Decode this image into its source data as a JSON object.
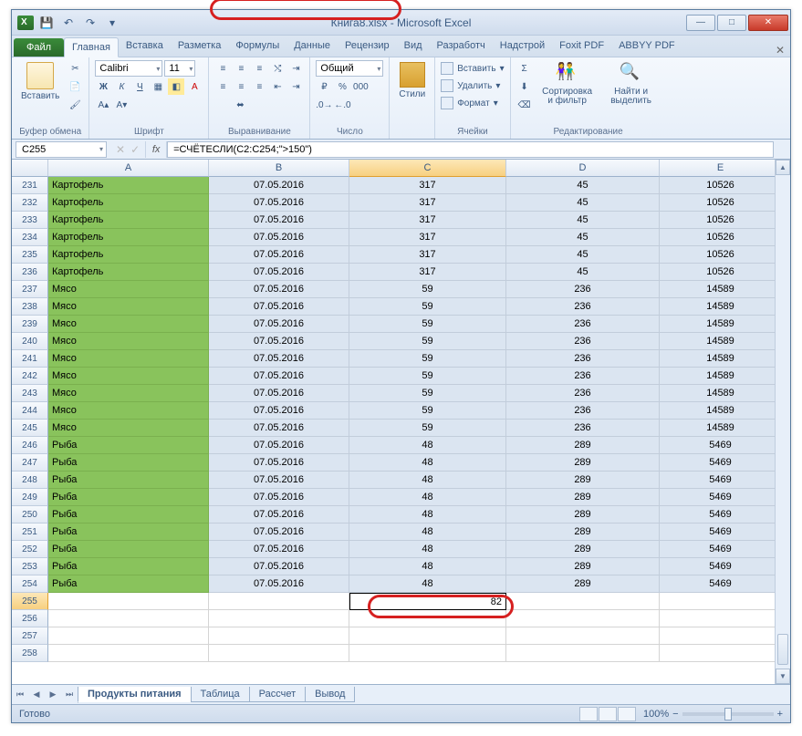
{
  "window": {
    "title": "Книга8.xlsx - Microsoft Excel"
  },
  "qat": {
    "save": "💾",
    "undo": "↶",
    "redo": "↷",
    "customize": "▾"
  },
  "win_controls": {
    "min": "—",
    "max": "□",
    "close": "✕"
  },
  "ribbon_tabs": {
    "file": "Файл",
    "items": [
      "Главная",
      "Вставка",
      "Разметка",
      "Формулы",
      "Данные",
      "Рецензир",
      "Вид",
      "Разработч",
      "Надстрой",
      "Foxit PDF",
      "ABBYY PDF"
    ],
    "active_index": 0
  },
  "ribbon": {
    "clipboard": {
      "paste": "Вставить",
      "label": "Буфер обмена"
    },
    "font": {
      "name": "Calibri",
      "size": "11",
      "bold": "Ж",
      "italic": "К",
      "underline": "Ч",
      "label": "Шрифт"
    },
    "alignment": {
      "label": "Выравнивание"
    },
    "number": {
      "format": "Общий",
      "label": "Число"
    },
    "styles": {
      "btn": "Стили",
      "label": ""
    },
    "cells": {
      "insert": "Вставить",
      "delete": "Удалить",
      "format": "Формат",
      "label": "Ячейки"
    },
    "editing": {
      "sort": "Сортировка и фильтр",
      "find": "Найти и выделить",
      "label": "Редактирование"
    }
  },
  "formula_bar": {
    "name_box": "C255",
    "fx": "fx",
    "formula": "=СЧЁТЕСЛИ(C2:C254;\">150\")"
  },
  "columns": [
    "",
    "A",
    "B",
    "C",
    "D",
    "E"
  ],
  "selected_column_index": 3,
  "rows": [
    {
      "n": 231,
      "a": "Картофель",
      "b": "07.05.2016",
      "c": "317",
      "d": "45",
      "e": "10526"
    },
    {
      "n": 232,
      "a": "Картофель",
      "b": "07.05.2016",
      "c": "317",
      "d": "45",
      "e": "10526"
    },
    {
      "n": 233,
      "a": "Картофель",
      "b": "07.05.2016",
      "c": "317",
      "d": "45",
      "e": "10526"
    },
    {
      "n": 234,
      "a": "Картофель",
      "b": "07.05.2016",
      "c": "317",
      "d": "45",
      "e": "10526"
    },
    {
      "n": 235,
      "a": "Картофель",
      "b": "07.05.2016",
      "c": "317",
      "d": "45",
      "e": "10526"
    },
    {
      "n": 236,
      "a": "Картофель",
      "b": "07.05.2016",
      "c": "317",
      "d": "45",
      "e": "10526"
    },
    {
      "n": 237,
      "a": "Мясо",
      "b": "07.05.2016",
      "c": "59",
      "d": "236",
      "e": "14589"
    },
    {
      "n": 238,
      "a": "Мясо",
      "b": "07.05.2016",
      "c": "59",
      "d": "236",
      "e": "14589"
    },
    {
      "n": 239,
      "a": "Мясо",
      "b": "07.05.2016",
      "c": "59",
      "d": "236",
      "e": "14589"
    },
    {
      "n": 240,
      "a": "Мясо",
      "b": "07.05.2016",
      "c": "59",
      "d": "236",
      "e": "14589"
    },
    {
      "n": 241,
      "a": "Мясо",
      "b": "07.05.2016",
      "c": "59",
      "d": "236",
      "e": "14589"
    },
    {
      "n": 242,
      "a": "Мясо",
      "b": "07.05.2016",
      "c": "59",
      "d": "236",
      "e": "14589"
    },
    {
      "n": 243,
      "a": "Мясо",
      "b": "07.05.2016",
      "c": "59",
      "d": "236",
      "e": "14589"
    },
    {
      "n": 244,
      "a": "Мясо",
      "b": "07.05.2016",
      "c": "59",
      "d": "236",
      "e": "14589"
    },
    {
      "n": 245,
      "a": "Мясо",
      "b": "07.05.2016",
      "c": "59",
      "d": "236",
      "e": "14589"
    },
    {
      "n": 246,
      "a": "Рыба",
      "b": "07.05.2016",
      "c": "48",
      "d": "289",
      "e": "5469"
    },
    {
      "n": 247,
      "a": "Рыба",
      "b": "07.05.2016",
      "c": "48",
      "d": "289",
      "e": "5469"
    },
    {
      "n": 248,
      "a": "Рыба",
      "b": "07.05.2016",
      "c": "48",
      "d": "289",
      "e": "5469"
    },
    {
      "n": 249,
      "a": "Рыба",
      "b": "07.05.2016",
      "c": "48",
      "d": "289",
      "e": "5469"
    },
    {
      "n": 250,
      "a": "Рыба",
      "b": "07.05.2016",
      "c": "48",
      "d": "289",
      "e": "5469"
    },
    {
      "n": 251,
      "a": "Рыба",
      "b": "07.05.2016",
      "c": "48",
      "d": "289",
      "e": "5469"
    },
    {
      "n": 252,
      "a": "Рыба",
      "b": "07.05.2016",
      "c": "48",
      "d": "289",
      "e": "5469"
    },
    {
      "n": 253,
      "a": "Рыба",
      "b": "07.05.2016",
      "c": "48",
      "d": "289",
      "e": "5469"
    },
    {
      "n": 254,
      "a": "Рыба",
      "b": "07.05.2016",
      "c": "48",
      "d": "289",
      "e": "5469"
    }
  ],
  "result_row": {
    "n": 255,
    "value": "82"
  },
  "sheets": {
    "tabs": [
      "Продукты питания",
      "Таблица",
      "Рассчет",
      "Вывод"
    ],
    "active_index": 0
  },
  "status": {
    "ready": "Готово",
    "zoom": "100%",
    "zoom_minus": "−",
    "zoom_plus": "+"
  }
}
